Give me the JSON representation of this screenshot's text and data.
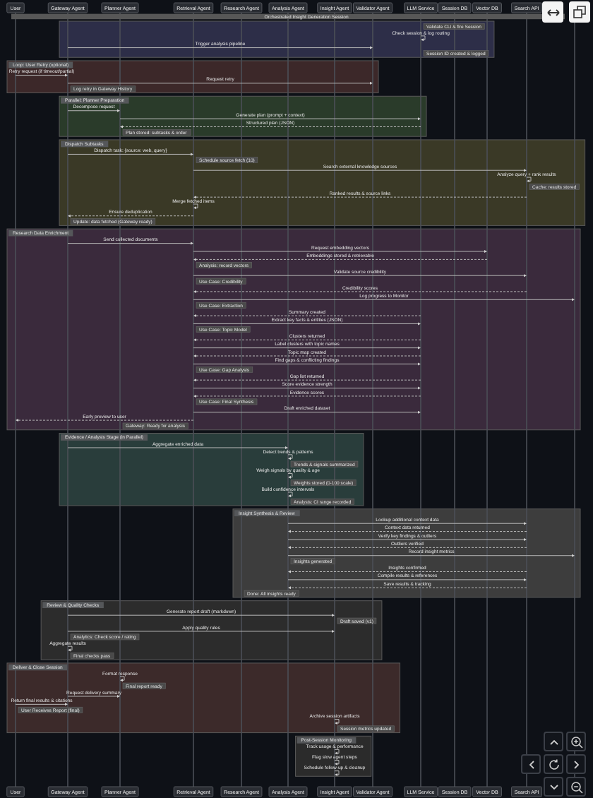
{
  "diagram_title": "Orchestrated Insight Generation Session",
  "participants": [
    {
      "label": "User"
    },
    {
      "label": "Gateway Agent"
    },
    {
      "label": "Planner Agent"
    },
    {
      "label": "Retrieval Agent"
    },
    {
      "label": "Research Agent"
    },
    {
      "label": "Analysis Agent"
    },
    {
      "label": "Insight Agent"
    },
    {
      "label": "Validator Agent"
    },
    {
      "label": "LLM Service"
    },
    {
      "label": "Session DB"
    },
    {
      "label": "Vector DB"
    },
    {
      "label": "Search API"
    }
  ],
  "fragments": [
    {
      "color": "#2d2e48",
      "events": [
        {
          "kind": "note",
          "label": "Validate CLI & fire Session"
        },
        {
          "kind": "self",
          "label": "Check session & log routing"
        },
        {
          "kind": "message",
          "label": "Trigger analysis pipeline"
        },
        {
          "kind": "note",
          "label": "Session ID created & logged"
        }
      ]
    },
    {
      "label": "Loop: User Retry (optional)",
      "color": "#3c2829",
      "events": [
        {
          "kind": "message",
          "label": "Retry request (if timeout/partial)"
        },
        {
          "kind": "message",
          "label": "Request retry"
        },
        {
          "kind": "note",
          "label": "Log retry in Gateway History"
        }
      ]
    },
    {
      "label": "Parallel: Planner Preparation",
      "color": "#2a3b2a",
      "events": [
        {
          "kind": "message",
          "label": "Decompose request"
        },
        {
          "kind": "message",
          "label": "Generate plan (prompt + context)"
        },
        {
          "kind": "reply",
          "label": "Structured plan (JSON)"
        },
        {
          "kind": "note",
          "label": "Plan stored: subtasks & order"
        }
      ]
    },
    {
      "label": "Dispatch Subtasks",
      "color": "#3a3926",
      "events": [
        {
          "kind": "message",
          "label": "Dispatch task: {source: web, query}"
        },
        {
          "kind": "note",
          "label": "Schedule source fetch (10)"
        },
        {
          "kind": "message",
          "label": "Search external knowledge sources"
        },
        {
          "kind": "self",
          "label": "Analyze query + rank results"
        },
        {
          "kind": "note",
          "label": "Cache: results stored"
        },
        {
          "kind": "reply",
          "label": "Ranked results & source links"
        },
        {
          "kind": "self",
          "label": "Merge fetched items"
        },
        {
          "kind": "reply",
          "label": "Ensure deduplication"
        },
        {
          "kind": "note",
          "label": "Update: data fetched (Gateway ready)"
        }
      ]
    },
    {
      "label": "Research Data Enrichment",
      "color": "#3a2a3c",
      "events": [
        {
          "kind": "message",
          "label": "Send collected documents"
        },
        {
          "kind": "message",
          "label": "Request embedding vectors"
        },
        {
          "kind": "reply",
          "label": "Embeddings stored & retrievable"
        },
        {
          "kind": "note",
          "label": "Analysis: record vectors"
        },
        {
          "kind": "message",
          "label": "Validate source credibility"
        },
        {
          "kind": "note",
          "label": "Use Case: Credibility"
        },
        {
          "kind": "reply",
          "label": "Credibility scores"
        },
        {
          "kind": "message",
          "label": "Log progress to Monitor"
        },
        {
          "kind": "note",
          "label": "Use Case: Extraction"
        },
        {
          "kind": "reply",
          "label": "Summary created"
        },
        {
          "kind": "message",
          "label": "Extract key facts & entities (JSON)"
        },
        {
          "kind": "note",
          "label": "Use Case: Topic Model"
        },
        {
          "kind": "reply",
          "label": "Clusters returned"
        },
        {
          "kind": "message",
          "label": "Label clusters with topic names"
        },
        {
          "kind": "reply",
          "label": "Topic map created"
        },
        {
          "kind": "message",
          "label": "Find gaps & conflicting findings"
        },
        {
          "kind": "note",
          "label": "Use Case: Gap Analysis"
        },
        {
          "kind": "reply",
          "label": "Gap list returned"
        },
        {
          "kind": "message",
          "label": "Score evidence strength"
        },
        {
          "kind": "reply",
          "label": "Evidence scores"
        },
        {
          "kind": "note",
          "label": "Use Case: Final Synthesis"
        },
        {
          "kind": "message",
          "label": "Draft enriched dataset"
        },
        {
          "kind": "reply",
          "label": "Early preview to user"
        },
        {
          "kind": "note",
          "label": "Gateway: Ready for analysis"
        }
      ]
    },
    {
      "label": "Evidence / Analysis Stage (in Parallel)",
      "color": "#293d3b",
      "events": [
        {
          "kind": "message",
          "label": "Aggregate enriched data"
        },
        {
          "kind": "self",
          "label": "Detect trends & patterns"
        },
        {
          "kind": "note",
          "label": "Trends & signals summarized"
        },
        {
          "kind": "self",
          "label": "Weigh signals by quality & age"
        },
        {
          "kind": "note",
          "label": "Weights stored (0-100 scale)"
        },
        {
          "kind": "self",
          "label": "Build confidence intervals"
        },
        {
          "kind": "note",
          "label": "Analysis: CI range recorded"
        }
      ]
    },
    {
      "label": "Insight Synthesis & Review",
      "color": "#3d3d3d",
      "events": [
        {
          "kind": "message",
          "label": "Lookup additional context data"
        },
        {
          "kind": "reply",
          "label": "Context data returned"
        },
        {
          "kind": "message",
          "label": "Verify key findings & outliers"
        },
        {
          "kind": "reply",
          "label": "Outliers verified"
        },
        {
          "kind": "message",
          "label": "Record insight metrics"
        },
        {
          "kind": "note",
          "label": "Insights generated"
        },
        {
          "kind": "reply",
          "label": "Insights confirmed"
        },
        {
          "kind": "message",
          "label": "Compile results & references"
        },
        {
          "kind": "reply",
          "label": "Save results & tracking"
        },
        {
          "kind": "note",
          "label": "Done: All insights ready"
        }
      ]
    },
    {
      "label": "Review & Quality Checks",
      "color": "#2c2c2c",
      "events": [
        {
          "kind": "message",
          "label": "Generate report draft (markdown)"
        },
        {
          "kind": "note",
          "label": "Draft saved (v1)"
        },
        {
          "kind": "message",
          "label": "Apply quality rules"
        },
        {
          "kind": "note",
          "label": "Analytics: Check score / rating"
        },
        {
          "kind": "self",
          "label": "Aggregate results"
        },
        {
          "kind": "note",
          "label": "Final checks pass"
        }
      ]
    },
    {
      "label": "Deliver & Close Session",
      "color": "#3c2a2a",
      "events": [
        {
          "kind": "self",
          "label": "Format response"
        },
        {
          "kind": "note",
          "label": "Final report ready"
        },
        {
          "kind": "message",
          "label": "Request delivery summary"
        },
        {
          "kind": "message",
          "label": "Return final results & citations"
        },
        {
          "kind": "note",
          "label": "User Receives Report (final)"
        },
        {
          "kind": "self",
          "label": "Archive session artifacts"
        },
        {
          "kind": "note",
          "label": "Session metrics updated"
        }
      ]
    },
    {
      "label": "Post-Session Monitoring",
      "color": "#2b2b2b",
      "events": [
        {
          "kind": "self",
          "label": "Track usage & performance"
        },
        {
          "kind": "self",
          "label": "Flag slow agent steps"
        },
        {
          "kind": "self",
          "label": "Schedule follow-up & cleanup"
        }
      ]
    }
  ],
  "footer_participants": [
    {
      "label": "User"
    },
    {
      "label": "Gateway Agent"
    },
    {
      "label": "Planner Agent"
    },
    {
      "label": "Retrieval Agent"
    },
    {
      "label": "Research Agent"
    },
    {
      "label": "Analysis Agent"
    },
    {
      "label": "Insight Agent"
    },
    {
      "label": "Validator Agent"
    },
    {
      "label": "LLM Service"
    },
    {
      "label": "Session DB"
    },
    {
      "label": "Vector DB"
    },
    {
      "label": "Search API"
    }
  ]
}
